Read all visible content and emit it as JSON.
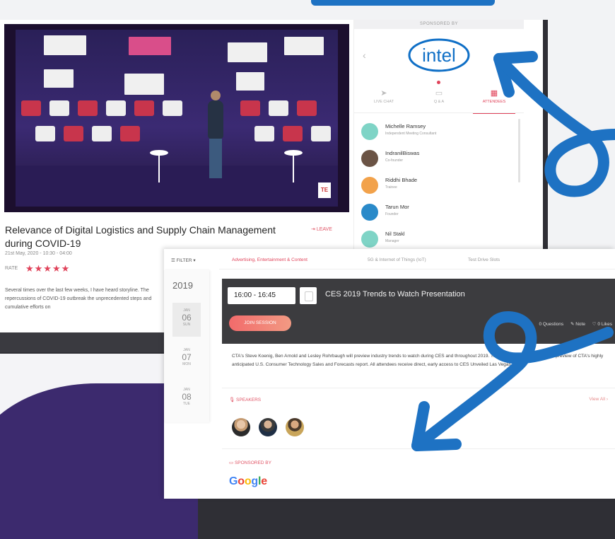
{
  "sidebar": {
    "sponsored_label": "SPONSORED BY",
    "sponsor_logo_text": "intel",
    "tabs": [
      {
        "label": "LIVE CHAT",
        "icon": "send-icon"
      },
      {
        "label": "Q & A",
        "icon": "qa-icon"
      },
      {
        "label": "ATTENDEES",
        "icon": "calendar-icon"
      }
    ],
    "attendees": [
      {
        "name": "Michelle Ramsey",
        "role": "Independent Meeting Consultant",
        "color": "#7fd4c6"
      },
      {
        "name": "IndranilBiswas",
        "role": "Co-founder",
        "color": "#6b5445"
      },
      {
        "name": "Riddhi Bhade",
        "role": "Trainee",
        "color": "#f2a24b"
      },
      {
        "name": "Tarun Mor",
        "role": "Founder",
        "color": "#2a8ac9"
      },
      {
        "name": "Nil Stakl",
        "role": "Manager",
        "color": "#7fd4c6"
      }
    ]
  },
  "main": {
    "session_title": "Relevance of Digital Logistics and Supply Chain Management during COVID-19",
    "leave_label": "LEAVE",
    "date": "21st May, 2020 - 10:30 - 04:00",
    "rate_label": "RATE",
    "stars": "★★★★★",
    "description": "Several times over the last few weeks, I have heard storyline. The repercussions of COVID-19 outbreak the unprecedented steps and cumulative efforts on",
    "video_corner_label": "TE"
  },
  "schedule": {
    "filter_label": "☰ FILTER ▾",
    "tabs": [
      "Advertising, Entertainment & Content",
      "5G & Internet of Things (IoT)",
      "Test Drive Slots"
    ],
    "year": "2019",
    "days": [
      {
        "month": "JAN",
        "day": "06",
        "dow": "SUN"
      },
      {
        "month": "JAN",
        "day": "07",
        "dow": "MON"
      },
      {
        "month": "JAN",
        "day": "08",
        "dow": "TUE"
      }
    ],
    "time": "16:00 - 16:45",
    "card_title": "CES 2019 Trends to Watch Presentation",
    "join_label": "JOIN SESSION",
    "questions": "0 Questions",
    "note": "✎ Note",
    "likes": "♡ 0 Likes",
    "card_description": "CTA's Steve Koenig, Ben Arnold and Lesley Rohrbaugh will preview industry trends to watch during CES and throughout 2019. They will also give an exclusive preview of CTA's highly anticipated U.S. Consumer Technology Sales and Forecasts report. All attendees receive direct, early access to CES Unveiled Las Vegas.",
    "speakers_label": "🎙 SPEAKERS",
    "view_all": "View All ›",
    "sponsored_label": "▭ SPONSORED BY",
    "google_letters": [
      {
        "ch": "G",
        "color": "#4285f4"
      },
      {
        "ch": "o",
        "color": "#ea4335"
      },
      {
        "ch": "o",
        "color": "#fbbc05"
      },
      {
        "ch": "g",
        "color": "#4285f4"
      },
      {
        "ch": "l",
        "color": "#34a853"
      },
      {
        "ch": "e",
        "color": "#ea4335"
      }
    ]
  },
  "colors": {
    "accent": "#e0435a",
    "arrow_blue": "#1e72c3",
    "intel_blue": "#0f6fc6"
  }
}
